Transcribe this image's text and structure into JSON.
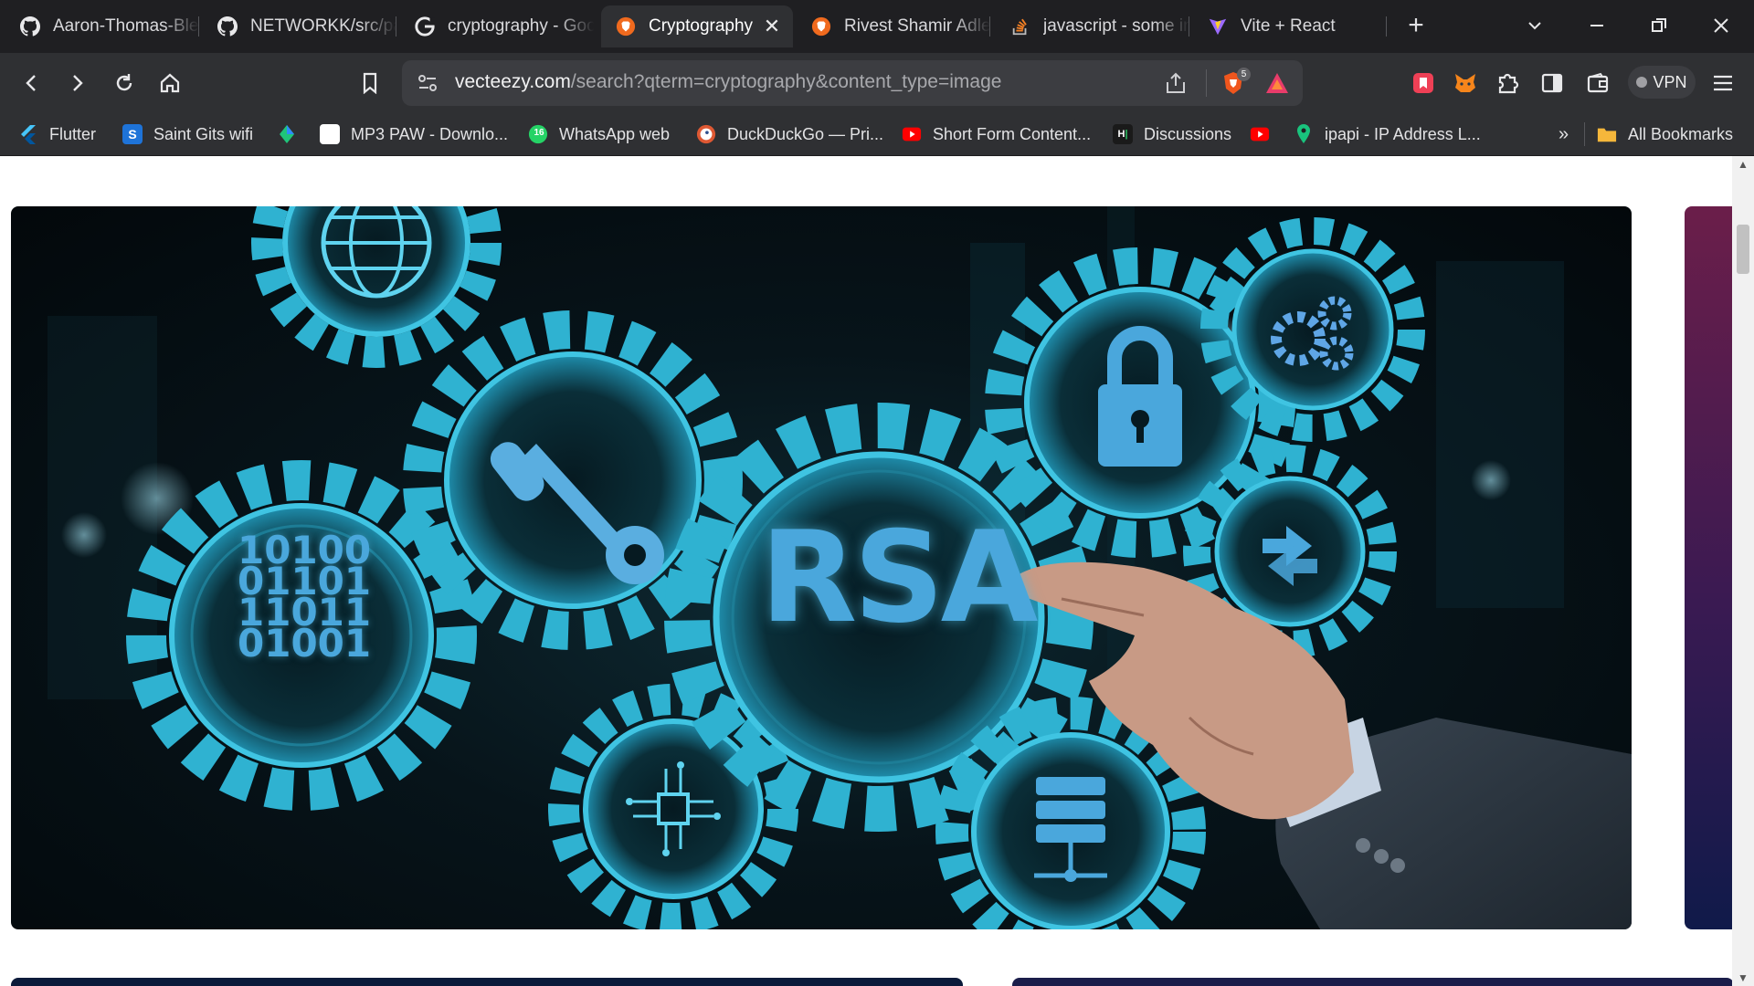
{
  "tabs": [
    {
      "title": "Aaron-Thomas-Blessen",
      "icon": "github-icon"
    },
    {
      "title": "NETWORKK/src/pages",
      "icon": "github-icon"
    },
    {
      "title": "cryptography - Google Search",
      "icon": "google-icon"
    },
    {
      "title": "Cryptography",
      "icon": "brave-icon",
      "active": true
    },
    {
      "title": "Rivest Shamir Adleman",
      "icon": "brave-icon"
    },
    {
      "title": "javascript - some input",
      "icon": "stackoverflow-icon"
    },
    {
      "title": "Vite + React",
      "icon": "vite-icon"
    }
  ],
  "address_bar": {
    "domain": "vecteezy.com",
    "path": "/search?qterm=cryptography&content_type=image"
  },
  "shield_badge": "5",
  "vpn_label": "VPN",
  "bookmarks": [
    {
      "label": "Flutter"
    },
    {
      "label": "Saint Gits wifi"
    },
    {
      "label": ""
    },
    {
      "label": "MP3 PAW - Downlo..."
    },
    {
      "label": "WhatsApp web"
    },
    {
      "label": "DuckDuckGo — Pri..."
    },
    {
      "label": "Short Form Content..."
    },
    {
      "label": "Discussions"
    },
    {
      "label": ""
    },
    {
      "label": "ipapi - IP Address L..."
    }
  ],
  "bookmarks_overflow": "»",
  "all_bookmarks_label": "All Bookmarks",
  "whatsapp_badge": "16",
  "hero_image": {
    "center_text": "RSA",
    "binary_lines": [
      "10100",
      "01101",
      "11011",
      "01001"
    ]
  },
  "colors": {
    "glow": "#3fb7d6",
    "hero_bg": "#07141a",
    "chrome": "#2f3033"
  }
}
